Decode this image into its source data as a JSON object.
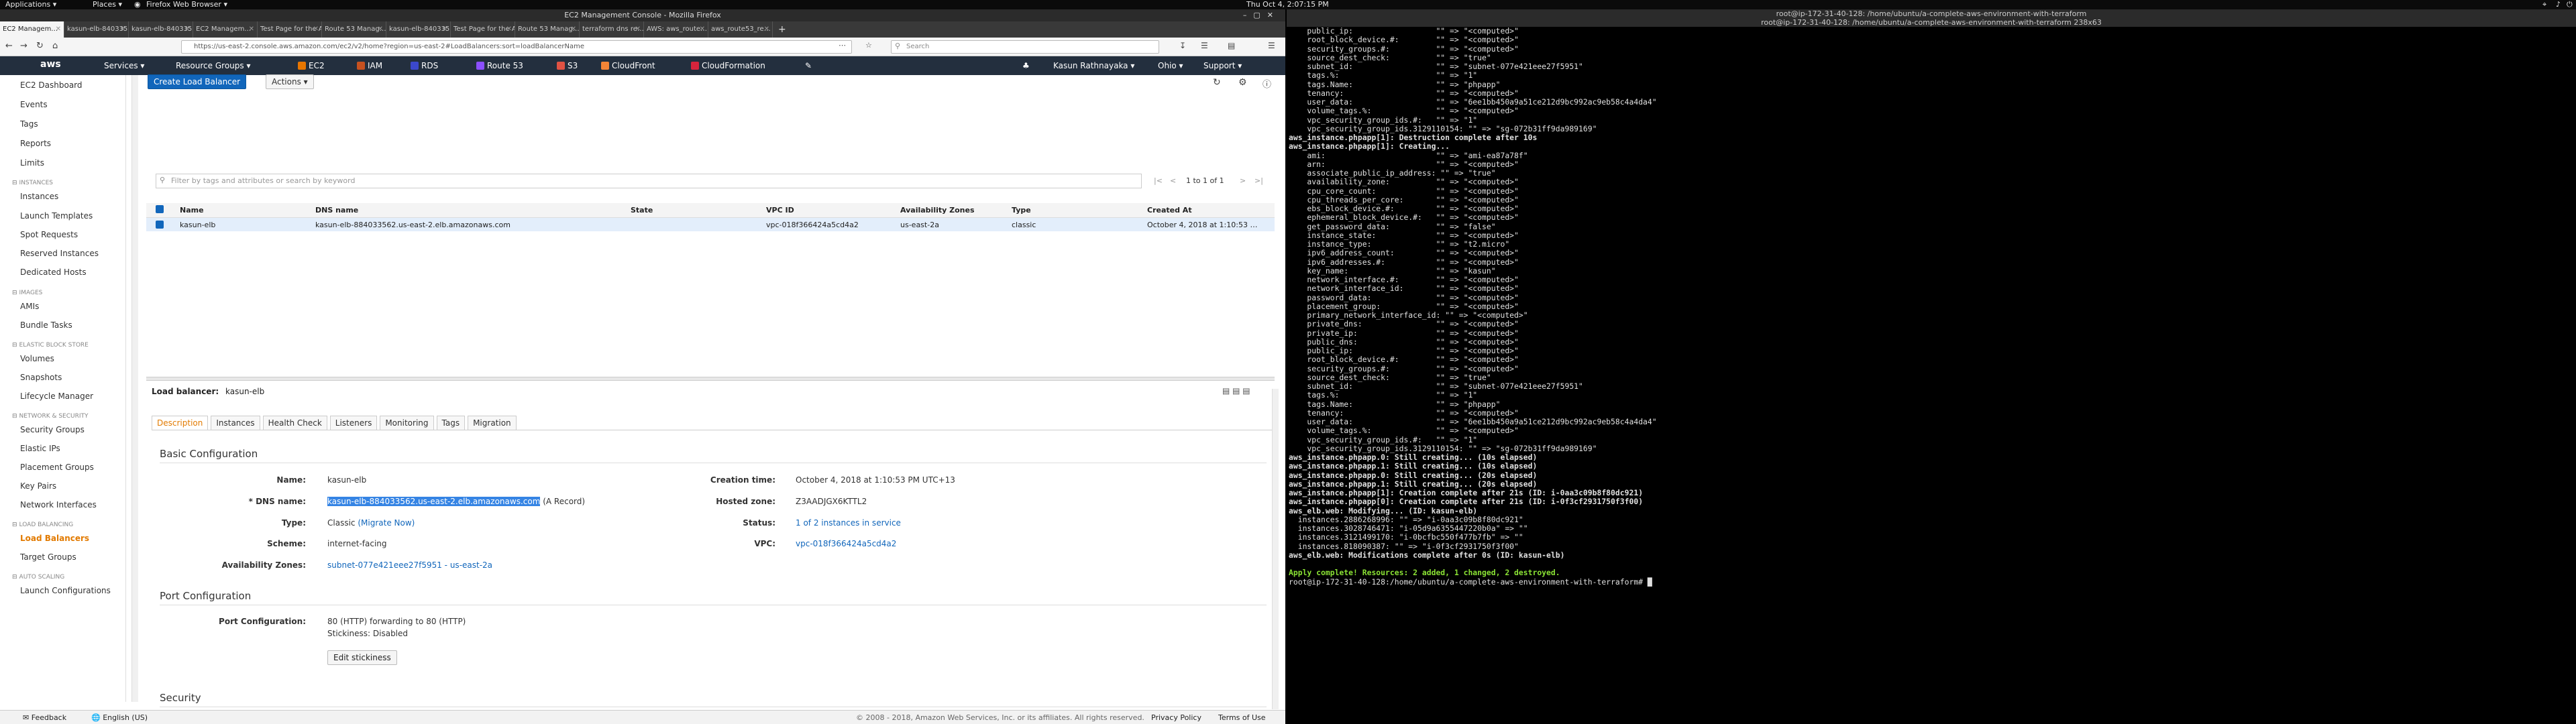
{
  "gnome": {
    "apps": "Applications ▾",
    "places": "Places ▾",
    "browser": "Firefox Web Browser ▾",
    "clock": "Thu Oct  4,  2:07:15 PM"
  },
  "firefox": {
    "window_title": "EC2 Management Console - Mozilla Firefox",
    "tabs": [
      {
        "label": "EC2 Managem…"
      },
      {
        "label": "kasun-elb-840335…"
      },
      {
        "label": "kasun-elb-840335…"
      },
      {
        "label": "EC2 Managem…"
      },
      {
        "label": "Test Page for the A…"
      },
      {
        "label": "Route 53 Manag…"
      },
      {
        "label": "kasun-elb-840335…"
      },
      {
        "label": "Test Page for the A…"
      },
      {
        "label": "Route 53 Manag…"
      },
      {
        "label": "terraform dns re…"
      },
      {
        "label": "AWS: aws_route…"
      },
      {
        "label": "aws_route53_re…"
      }
    ],
    "url": "https://us-east-2.console.aws.amazon.com/ec2/v2/home?region=us-east-2#LoadBalancers:sort=loadBalancerName",
    "search_placeholder": "Search"
  },
  "aws_nav": {
    "services": "Services ▾",
    "resource_groups": "Resource Groups ▾",
    "shortcuts": [
      {
        "label": "EC2",
        "color": "#e77600"
      },
      {
        "label": "IAM",
        "color": "#c7511f"
      },
      {
        "label": "RDS",
        "color": "#3b48cc"
      },
      {
        "label": "Route 53",
        "color": "#8c4fff"
      },
      {
        "label": "S3",
        "color": "#e05243"
      },
      {
        "label": "CloudFront",
        "color": "#f58536"
      },
      {
        "label": "CloudFormation",
        "color": "#d6243c"
      }
    ],
    "user": "Kasun Rathnayaka ▾",
    "region": "Ohio ▾",
    "support": "Support ▾"
  },
  "sidebar": {
    "items": [
      {
        "label": "EC2 Dashboard"
      },
      {
        "label": "Events"
      },
      {
        "label": "Tags"
      },
      {
        "label": "Reports"
      },
      {
        "label": "Limits"
      },
      {
        "section": "INSTANCES"
      },
      {
        "label": "Instances"
      },
      {
        "label": "Launch Templates"
      },
      {
        "label": "Spot Requests"
      },
      {
        "label": "Reserved Instances"
      },
      {
        "label": "Dedicated Hosts"
      },
      {
        "section": "IMAGES"
      },
      {
        "label": "AMIs"
      },
      {
        "label": "Bundle Tasks"
      },
      {
        "section": "ELASTIC BLOCK STORE"
      },
      {
        "label": "Volumes"
      },
      {
        "label": "Snapshots"
      },
      {
        "label": "Lifecycle Manager"
      },
      {
        "section": "NETWORK & SECURITY"
      },
      {
        "label": "Security Groups"
      },
      {
        "label": "Elastic IPs"
      },
      {
        "label": "Placement Groups"
      },
      {
        "label": "Key Pairs"
      },
      {
        "label": "Network Interfaces"
      },
      {
        "section": "LOAD BALANCING"
      },
      {
        "label": "Load Balancers",
        "active": true
      },
      {
        "label": "Target Groups"
      },
      {
        "section": "AUTO SCALING"
      },
      {
        "label": "Launch Configurations"
      }
    ]
  },
  "toolbar": {
    "create_label": "Create Load Balancer",
    "actions_label": "Actions ▾"
  },
  "filter": {
    "placeholder": "Filter by tags and attributes or search by keyword",
    "pagination": "1 to 1 of 1"
  },
  "table": {
    "headers": [
      "Name",
      "DNS name",
      "State",
      "VPC ID",
      "Availability Zones",
      "Type",
      "Created At"
    ],
    "rows": [
      [
        "kasun-elb",
        "kasun-elb-884033562.us-east-2.elb.amazonaws.com",
        "",
        "vpc-018f366424a5cd4a2",
        "us-east-2a",
        "classic",
        "October 4, 2018 at 1:10:53 …"
      ]
    ]
  },
  "details": {
    "title_label": "Load balancer:",
    "title_value": "kasun-elb",
    "tabs": [
      "Description",
      "Instances",
      "Health Check",
      "Listeners",
      "Monitoring",
      "Tags",
      "Migration"
    ],
    "basic_heading": "Basic Configuration",
    "name_label": "Name:",
    "name_value": "kasun-elb",
    "dns_label": "* DNS name:",
    "dns_value": "kasun-elb-884033562.us-east-2.elb.amazonaws.com",
    "dns_suffix": "(A Record)",
    "type_label": "Type:",
    "type_value": "Classic",
    "type_link": "(Migrate Now)",
    "scheme_label": "Scheme:",
    "scheme_value": "internet-facing",
    "az_label": "Availability Zones:",
    "az_value": "subnet-077e421eee27f5951 - us-east-2a",
    "created_label": "Creation time:",
    "created_value": "October 4, 2018 at 1:10:53 PM UTC+13",
    "zone_label": "Hosted zone:",
    "zone_value": "Z3AADJGX6KTTL2",
    "status_label": "Status:",
    "status_value": "1 of 2 instances in service",
    "vpc_label": "VPC:",
    "vpc_value": "vpc-018f366424a5cd4a2",
    "port_heading": "Port Configuration",
    "port_label": "Port Configuration:",
    "port_value": "80 (HTTP) forwarding to 80 (HTTP)",
    "stickiness": "Stickiness: Disabled",
    "edit_sticky": "Edit stickiness",
    "security_heading": "Security"
  },
  "footer": {
    "feedback": "Feedback",
    "language": "English (US)",
    "copyright": "© 2008 - 2018, Amazon Web Services, Inc. or its affiliates. All rights reserved.",
    "privacy": "Privacy Policy",
    "terms": "Terms of Use"
  },
  "terminal": {
    "title": "root@ip-172-31-40-128: /home/ubuntu/a-complete-aws-environment-with-terraform",
    "subtitle": "root@ip-172-31-40-128: /home/ubuntu/a-complete-aws-environment-with-terraform 238x63",
    "lines": [
      "    public_ip:                  \"\" => \"<computed>\"",
      "    root_block_device.#:        \"\" => \"<computed>\"",
      "    security_groups.#:          \"\" => \"<computed>\"",
      "    source_dest_check:          \"\" => \"true\"",
      "    subnet_id:                  \"\" => \"subnet-077e421eee27f5951\"",
      "    tags.%:                     \"\" => \"1\"",
      "    tags.Name:                  \"\" => \"phpapp\"",
      "    tenancy:                    \"\" => \"<computed>\"",
      "    user_data:                  \"\" => \"6ee1bb450a9a51ce212d9bc992ac9eb58c4a4da4\"",
      "    volume_tags.%:              \"\" => \"<computed>\"",
      "    vpc_security_group_ids.#:   \"\" => \"1\"",
      "    vpc_security_group_ids.3129110154: \"\" => \"sg-072b31ff9da989169\"",
      "aws_instance.phpapp[1]: Destruction complete after 10s",
      "aws_instance.phpapp[1]: Creating...",
      "    ami:                        \"\" => \"ami-ea87a78f\"",
      "    arn:                        \"\" => \"<computed>\"",
      "    associate_public_ip_address: \"\" => \"true\"",
      "    availability_zone:          \"\" => \"<computed>\"",
      "    cpu_core_count:             \"\" => \"<computed>\"",
      "    cpu_threads_per_core:       \"\" => \"<computed>\"",
      "    ebs_block_device.#:         \"\" => \"<computed>\"",
      "    ephemeral_block_device.#:   \"\" => \"<computed>\"",
      "    get_password_data:          \"\" => \"false\"",
      "    instance_state:             \"\" => \"<computed>\"",
      "    instance_type:              \"\" => \"t2.micro\"",
      "    ipv6_address_count:         \"\" => \"<computed>\"",
      "    ipv6_addresses.#:           \"\" => \"<computed>\"",
      "    key_name:                   \"\" => \"kasun\"",
      "    network_interface.#:        \"\" => \"<computed>\"",
      "    network_interface_id:       \"\" => \"<computed>\"",
      "    password_data:              \"\" => \"<computed>\"",
      "    placement_group:            \"\" => \"<computed>\"",
      "    primary_network_interface_id: \"\" => \"<computed>\"",
      "    private_dns:                \"\" => \"<computed>\"",
      "    private_ip:                 \"\" => \"<computed>\"",
      "    public_dns:                 \"\" => \"<computed>\"",
      "    public_ip:                  \"\" => \"<computed>\"",
      "    root_block_device.#:        \"\" => \"<computed>\"",
      "    security_groups.#:          \"\" => \"<computed>\"",
      "    source_dest_check:          \"\" => \"true\"",
      "    subnet_id:                  \"\" => \"subnet-077e421eee27f5951\"",
      "    tags.%:                     \"\" => \"1\"",
      "    tags.Name:                  \"\" => \"phpapp\"",
      "    tenancy:                    \"\" => \"<computed>\"",
      "    user_data:                  \"\" => \"6ee1bb450a9a51ce212d9bc992ac9eb58c4a4da4\"",
      "    volume_tags.%:              \"\" => \"<computed>\"",
      "    vpc_security_group_ids.#:   \"\" => \"1\"",
      "    vpc_security_group_ids.3129110154: \"\" => \"sg-072b31ff9da989169\"",
      "aws_instance.phpapp.0: Still creating... (10s elapsed)",
      "aws_instance.phpapp.1: Still creating... (10s elapsed)",
      "aws_instance.phpapp.0: Still creating... (20s elapsed)",
      "aws_instance.phpapp.1: Still creating... (20s elapsed)",
      "aws_instance.phpapp[1]: Creation complete after 21s (ID: i-0aa3c09b8f80dc921)",
      "aws_instance.phpapp[0]: Creation complete after 21s (ID: i-0f3cf2931750f3f00)",
      "aws_elb.web: Modifying... (ID: kasun-elb)",
      "  instances.2886268996: \"\" => \"i-0aa3c09b8f80dc921\"",
      "  instances.3028746471: \"i-05d9a6355447220b0a\" => \"\"",
      "  instances.3121499170: \"i-0bcfbc550f477b7fb\" => \"\"",
      "  instances.818090387: \"\" => \"i-0f3cf2931750f3f00\"",
      "aws_elb.web: Modifications complete after 0s (ID: kasun-elb)",
      "",
      "Apply complete! Resources: 2 added, 1 changed, 2 destroyed.",
      "root@ip-172-31-40-128:/home/ubuntu/a-complete-aws-environment-with-terraform# █"
    ]
  }
}
